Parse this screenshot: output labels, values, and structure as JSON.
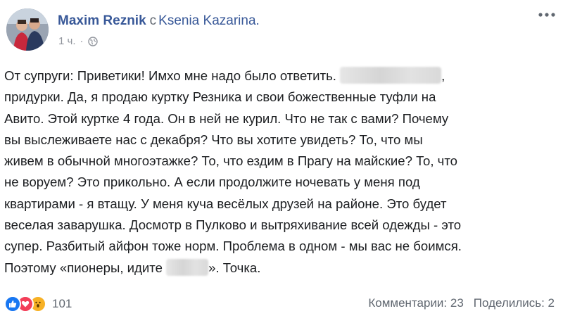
{
  "header": {
    "author": "Maxim Reznik",
    "with_word": "с",
    "tagged": "Ksenia Kazarina.",
    "time": "1 ч.",
    "separator": "·",
    "privacy_icon": "globe-icon",
    "more_icon": "more-horizontal-icon"
  },
  "post": {
    "lines": [
      {
        "a": "От супруги: Приветики! Имхо мне надо было ответить.",
        "b": ","
      },
      {
        "a": "придурки. Да, я продаю куртку Резника и свои божественные туфли на"
      },
      {
        "a": "Авито. Этой куртке 4 года. Он в ней не курил. Что не так с вами? Почему"
      },
      {
        "a": "вы выслеживаете нас с декабря? Что вы хотите увидеть? То, что мы"
      },
      {
        "a": "живем в обычной многоэтажке? То, что ездим в Прагу на майские? То, что"
      },
      {
        "a": "не воруем? Это прикольно. А если продолжите ночевать у меня под"
      },
      {
        "a": "квартирами - я втащу. У меня куча весёлых друзей на районе. Это будет"
      },
      {
        "a": "веселая заварушка. Досмотр в Пулково и вытряхивание всей одежды - это"
      },
      {
        "a": "супер. Разбитый айфон тоже норм. Проблема в одном - мы вас не боимся."
      },
      {
        "a": "Поэтому «пионеры, идите",
        "b": "». Точка."
      }
    ]
  },
  "footer": {
    "reactions": [
      "like-icon",
      "love-icon",
      "wow-icon"
    ],
    "reaction_count": "101",
    "comments": "Комментарии: 23",
    "shares": "Поделились: 2"
  },
  "colors": {
    "link": "#385898",
    "meta": "#90949c",
    "like": "#1877f2",
    "love": "#f33e58",
    "wow": "#f7b125"
  }
}
